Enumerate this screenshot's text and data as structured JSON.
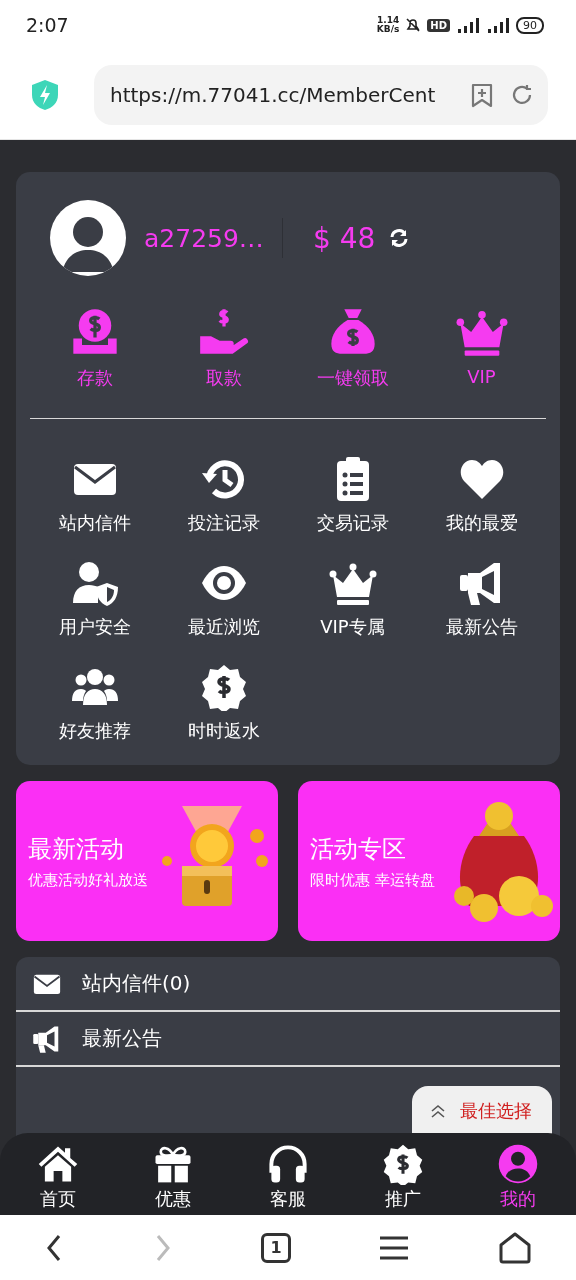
{
  "status_bar": {
    "time": "2:07",
    "net_speed": "1.14",
    "net_unit": "KB/s",
    "hd": "HD",
    "battery": "90"
  },
  "address_bar": {
    "url": "https://m.77041.cc/MemberCent"
  },
  "profile": {
    "username": "a27259…",
    "balance": "$ 48"
  },
  "wallet_actions": [
    {
      "label": "存款",
      "kind": "deposit"
    },
    {
      "label": "取款",
      "kind": "withdraw"
    },
    {
      "label": "一键领取",
      "kind": "moneybag"
    },
    {
      "label": "VIP",
      "kind": "crown"
    }
  ],
  "menu": [
    {
      "label": "站内信件",
      "kind": "mail"
    },
    {
      "label": "投注记录",
      "kind": "history"
    },
    {
      "label": "交易记录",
      "kind": "clipboard"
    },
    {
      "label": "我的最爱",
      "kind": "heart"
    },
    {
      "label": "用户安全",
      "kind": "usershield"
    },
    {
      "label": "最近浏览",
      "kind": "eye"
    },
    {
      "label": "VIP专属",
      "kind": "crown"
    },
    {
      "label": "最新公告",
      "kind": "megaphone"
    },
    {
      "label": "好友推荐",
      "kind": "users"
    },
    {
      "label": "时时返水",
      "kind": "badge"
    }
  ],
  "promos": [
    {
      "title": "最新活动",
      "subtitle": "优惠活动好礼放送",
      "kind": "chest"
    },
    {
      "title": "活动专区",
      "subtitle": "限时优惠 幸运转盘",
      "kind": "bag"
    }
  ],
  "list": [
    {
      "label": "站内信件(0)",
      "kind": "mail"
    },
    {
      "label": "最新公告",
      "kind": "megaphone"
    }
  ],
  "floating_button": {
    "label": "最佳选择"
  },
  "bottom_nav": [
    {
      "label": "首页",
      "kind": "home",
      "selected": false
    },
    {
      "label": "优惠",
      "kind": "gift",
      "selected": false
    },
    {
      "label": "客服",
      "kind": "headphones",
      "selected": false
    },
    {
      "label": "推广",
      "kind": "badge",
      "selected": false
    },
    {
      "label": "我的",
      "kind": "user",
      "selected": true
    }
  ],
  "browser_toolbar": {
    "tab_count": "1"
  }
}
